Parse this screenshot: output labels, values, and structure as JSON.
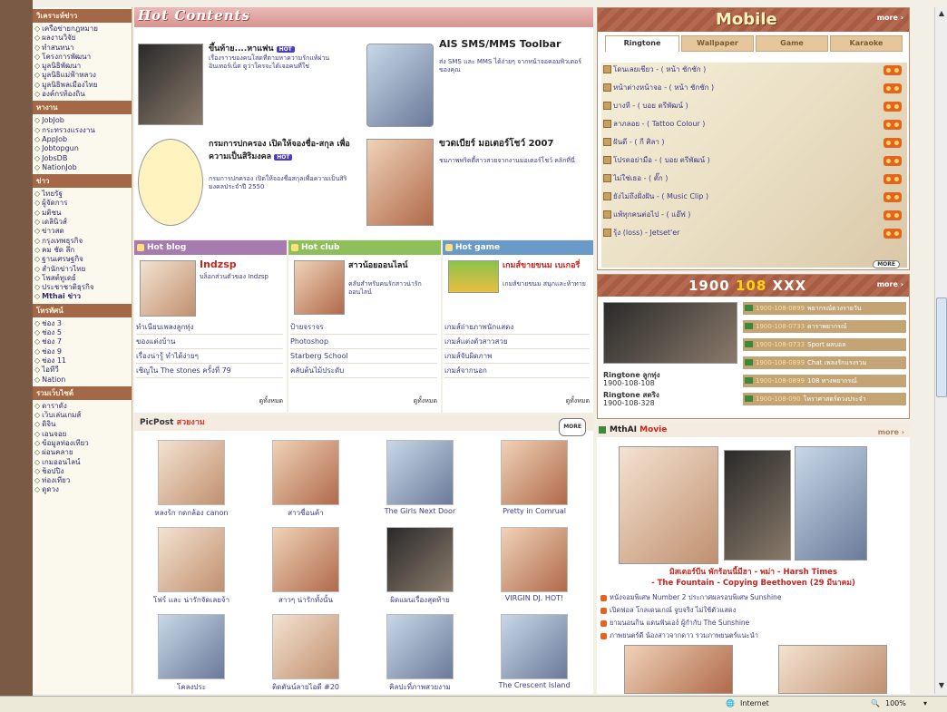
{
  "nav": {
    "sections": [
      {
        "header": "วิเคราะห์ข่าว",
        "items": [
          "เครือข่ายกฎหมาย",
          "ผลงานวิจัย",
          "ทำสนทนา",
          "โครงการพัฒนา",
          "มูลนิธิพัฒนา",
          "มูลนิธิแม่ฟ้าหลวง",
          "มูลนิธิพลเมืองไทย",
          "องค์กรท้องถิ่น"
        ]
      },
      {
        "header": "หางาน",
        "items": [
          "JobJob",
          "กระทรวงแรงงาน",
          "AppJob",
          "Jobtopgun",
          "JobsDB",
          "NationJob"
        ]
      },
      {
        "header": "ข่าว",
        "items": [
          "ไทยรัฐ",
          "ผู้จัดการ",
          "มติชน",
          "เดลินิวส์",
          "ข่าวสด",
          "กรุงเทพธุรกิจ",
          "คม ชัด ลึก",
          "ฐานเศรษฐกิจ",
          "สำนักข่าวไทย",
          "โพสต์ทูเดย์",
          "ประชาชาติธุรกิจ",
          "Mthai ข่าว"
        ]
      },
      {
        "header": "โทรทัศน์",
        "items": [
          "ช่อง 3",
          "ช่อง 5",
          "ช่อง 7",
          "ช่อง 9",
          "ช่อง 11",
          "ไอทีวี",
          "Nation"
        ]
      },
      {
        "header": "รวมเว็บไซต์",
        "items": [
          "ดาราดัง",
          "เว็บเล่นเกมส์",
          "ดิจิ่น",
          "เอนจอย",
          "ข้อมูลท่องเที่ยว",
          "ผ่อนคลาย",
          "เกมออนไลน์",
          "ช็อปปิ้ง",
          "ท่องเที่ยว",
          "ดูดวง"
        ]
      }
    ]
  },
  "hot": {
    "title": "Hot Contents",
    "badge": "HOT",
    "items": [
      {
        "title": "ขึ้นท้าย....หาแฟน",
        "desc": "เรื่องราวของคนโสดที่ตามหาความรักแท้ผ่านอินเทอร์เน็ต ดูว่าใครจะได้เจอคนที่ใช่"
      },
      {
        "title": "AIS SMS/MMS Toolbar",
        "desc": "ส่ง SMS และ MMS ได้ง่ายๆ จากหน้าจอคอมพิวเตอร์ของคุณ"
      },
      {
        "title": "กรมการปกครอง เปิดให้จองชื่อ-สกุล เพื่อความเป็นสิริมงคล",
        "desc": "กรมการปกครอง เปิดให้จองชื่อสกุลเพื่อความเป็นสิริมงคลประจำปี 2550"
      },
      {
        "title": "ขวดเบียร์ มอเตอร์โชว์ 2007",
        "desc": "ชมภาพพริตตี้สาวสวยจากงานมอเตอร์โชว์ คลิกที่นี่"
      }
    ]
  },
  "blog": {
    "title": "Hot blog",
    "name": "Indzsp",
    "desc": "บล็อกส่วนตัวของ Indzsp",
    "links": [
      "ทำเนียบเพลงลูกทุ่ง",
      "ของแต่งบ้าน",
      "เรื่องน่ารู้ ทำได้ง่ายๆ",
      "เชิญใน The stones ครั้งที่ 79"
    ],
    "see_all": "ดูทั้งหมด"
  },
  "club": {
    "title": "Hot club",
    "name": "สาวน้อยออนไลน์",
    "desc": "คลับสำหรับคนรักสาวน่ารักออนไลน์",
    "links": [
      "ป้ายจราจร",
      "Photoshop",
      "Starberg School",
      "คลับต้นไม้ประดับ"
    ],
    "see_all": "ดูทั้งหมด"
  },
  "game": {
    "title": "Hot game",
    "name": "เกมส์ขายขนม เบเกอรี่",
    "desc": "เกมส์ขายขนม สนุกและท้าทาย",
    "links": [
      "เกมส์ถ่ายภาพนักแสดง",
      "เกมส์แต่งตัวสาวสวย",
      "เกมส์จับผิดภาพ",
      "เกมส์จากนอก"
    ],
    "see_all": "ดูทั้งหมด"
  },
  "mobile": {
    "title": "Mobile",
    "more": "more",
    "tabs": [
      "Ringtone",
      "Wallpaper",
      "Game",
      "Karaoke"
    ],
    "ringtones": [
      "โดนเลยเชียว - ( หน้า ชักชัก )",
      "หน้าต่างหน้าจอ - ( หน้า ชักชัก )",
      "บางที - ( บอย ตรีพัฒน์ )",
      "ลาภลอย - ( Tattoo Colour )",
      "ฝันดี - ( กี ศิลา )",
      "โปรดอย่ามือ - ( บอย ตรีพัฒน์ )",
      "ไม่ใช่เธอ - ( ตั๊ก )",
      "ยังไม่ถึงฝั่งฝัน - ( Music Clip )",
      "แพ้ทุกคนต่อไป - ( แอ๊ฟ )",
      "รุ้ง (loss) - Jetset'er"
    ],
    "more_btn": "MORE"
  },
  "tel": {
    "num1": "1900",
    "num2": "108",
    "num3": "XXX",
    "more": "more",
    "ringtone1_label": "Ringtone ลูกทุ่ง",
    "ringtone1_num": "1900-108-108",
    "ringtone2_label": "Ringtone สตริง",
    "ringtone2_num": "1900-108-328",
    "rows": [
      {
        "num": "1900-108-0899",
        "label": "พยากรณ์ดวงรายวัน"
      },
      {
        "num": "1900-108-0733",
        "label": "ดาราพยากรณ์"
      },
      {
        "num": "1900-108-0733",
        "label": "Sport ผลบอล"
      },
      {
        "num": "1900-108-0899",
        "label": "Chat เพลงรักแรงรวม"
      },
      {
        "num": "1900-108-0899",
        "label": "108 ทางพยากรณ์"
      },
      {
        "num": "1900-108-090",
        "label": "โหราศาสตร์ดวงประจำ"
      }
    ]
  },
  "picpost": {
    "title": "PicPost",
    "title_red": "สวยงาม",
    "more_btn": "MORE",
    "items": [
      "หลงร้ก กดกล้อง canon",
      "สาวชื่อนค้า",
      "The Girls Next Door",
      "Pretty in Comrual",
      "โฟร์ และ น่ารักจัดเลยจ้า",
      "สาวๆ น่ารักทั้งนั้น",
      "ผิดแผนเรื่องสุดท้าย",
      "VIRGIN DJ. HOT!",
      "โคลงประ",
      "ติดตันน์ลายไอดี #20",
      "คิลปะที่ภาพสวยงาม",
      "The Crescent Island"
    ]
  },
  "movie": {
    "title": "MthAI",
    "title_red": "Movie",
    "more": "more",
    "caption1": "มิสเตอร์บีน พักร้อนนี้มีฮา - พม่า - Harsh Times",
    "caption2": "- The Fountain - Copying Beethoven (29 มีนาคม)",
    "links": [
      "หนังจอมพิเศษ Number 2 ประกาศผลรอบพิเศษ Sunshine",
      "เปิดฟอล โกลเดนเกณ์ จูบจริง ไม่ใช้ตัวแสดง",
      "ยามนอนกิน แดนฟันเอง์ ผู้กำกับ The Sunshine",
      "ภาพยนตร์ดี น้องสาวจากดาว รวมภาพยนตร์แนะนำ"
    ]
  },
  "status": {
    "zone": "Internet",
    "zoom": "100%"
  }
}
